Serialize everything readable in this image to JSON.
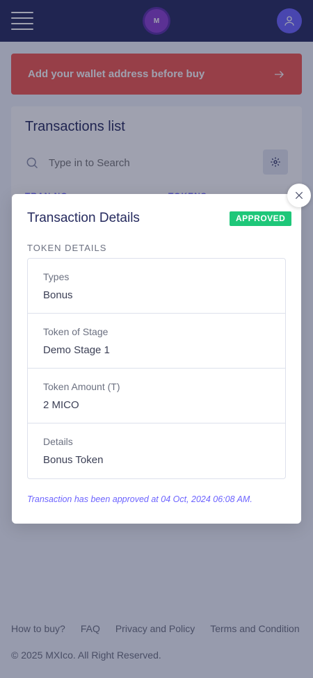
{
  "header": {
    "logo_text": "M",
    "icons": {
      "menu": "hamburger-icon",
      "user": "user-icon"
    }
  },
  "alert": {
    "text": "Add your wallet address before buy",
    "icon": "arrow-right-icon"
  },
  "transactions": {
    "title": "Transactions list",
    "search_placeholder": "Type in to Search",
    "columns": [
      "TRAN NO",
      "TOKENS"
    ]
  },
  "modal": {
    "title": "Transaction Details",
    "status": "APPROVED",
    "section_label": "TOKEN DETAILS",
    "fields": [
      {
        "label": "Types",
        "value": "Bonus"
      },
      {
        "label": "Token of Stage",
        "value": "Demo Stage 1"
      },
      {
        "label": "Token Amount (T)",
        "value": "2 MICO"
      },
      {
        "label": "Details",
        "value": "Bonus Token"
      }
    ],
    "note": "Transaction has been approved at 04 Oct, 2024 06:08 AM."
  },
  "footer": {
    "links": [
      "How to buy?",
      "FAQ",
      "Privacy and Policy",
      "Terms and Condition"
    ],
    "copyright": "© 2025 MXIco. All Right Reserved."
  },
  "colors": {
    "header_bg": "#252a5e",
    "alert_bg": "#f2564f",
    "accent": "#6c63ff",
    "approved": "#1ec779"
  }
}
